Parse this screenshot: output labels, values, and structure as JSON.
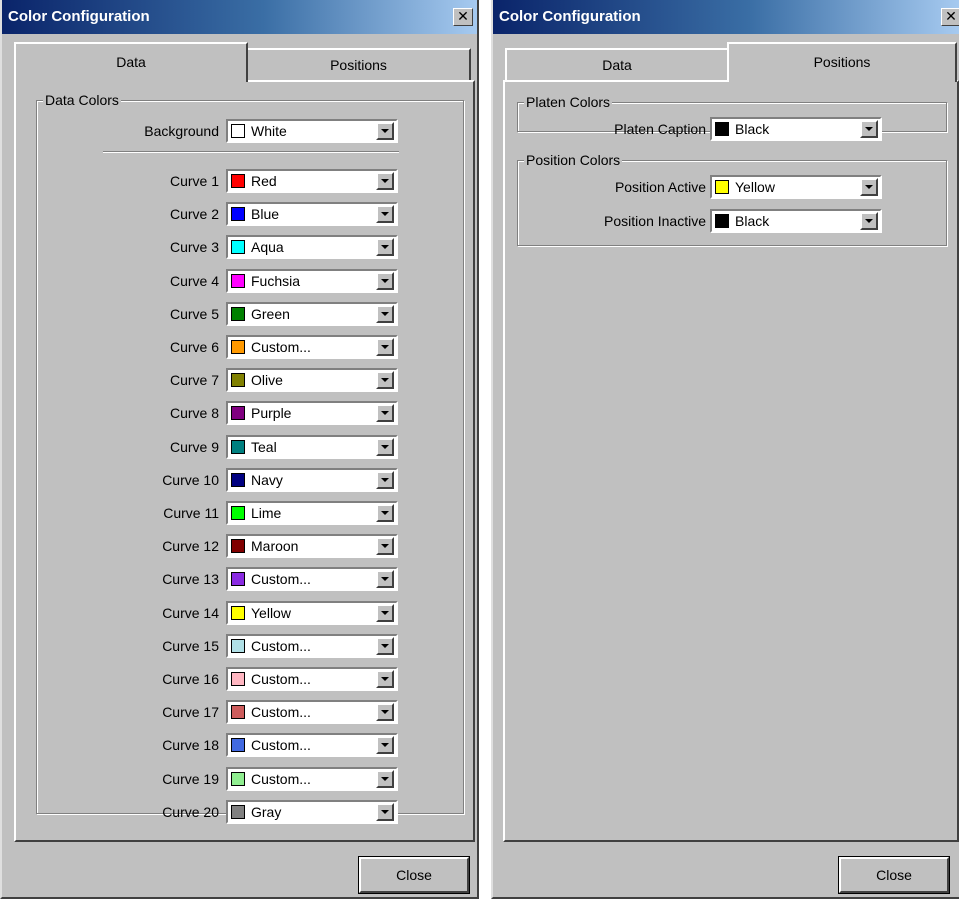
{
  "left_window": {
    "title": "Color Configuration",
    "close_glyph": "✕",
    "tabs": [
      {
        "label": "Data",
        "active": true
      },
      {
        "label": "Positions",
        "active": false
      }
    ],
    "group_label": "Data Colors",
    "background": {
      "label": "Background",
      "value": "White",
      "color": "#ffffff"
    },
    "curves": [
      {
        "label": "Curve 1",
        "value": "Red",
        "color": "#ff0000"
      },
      {
        "label": "Curve 2",
        "value": "Blue",
        "color": "#0000ff"
      },
      {
        "label": "Curve 3",
        "value": "Aqua",
        "color": "#00ffff"
      },
      {
        "label": "Curve 4",
        "value": "Fuchsia",
        "color": "#ff00ff"
      },
      {
        "label": "Curve 5",
        "value": "Green",
        "color": "#008000"
      },
      {
        "label": "Curve 6",
        "value": "Custom...",
        "color": "#ff9900"
      },
      {
        "label": "Curve 7",
        "value": "Olive",
        "color": "#808000"
      },
      {
        "label": "Curve 8",
        "value": "Purple",
        "color": "#800080"
      },
      {
        "label": "Curve 9",
        "value": "Teal",
        "color": "#008080"
      },
      {
        "label": "Curve 10",
        "value": "Navy",
        "color": "#000080"
      },
      {
        "label": "Curve 11",
        "value": "Lime",
        "color": "#00ff00"
      },
      {
        "label": "Curve 12",
        "value": "Maroon",
        "color": "#800000"
      },
      {
        "label": "Curve 13",
        "value": "Custom...",
        "color": "#8a2be2"
      },
      {
        "label": "Curve 14",
        "value": "Yellow",
        "color": "#ffff00"
      },
      {
        "label": "Curve 15",
        "value": "Custom...",
        "color": "#b0e0e6"
      },
      {
        "label": "Curve 16",
        "value": "Custom...",
        "color": "#ffb6c1"
      },
      {
        "label": "Curve 17",
        "value": "Custom...",
        "color": "#cd5c5c"
      },
      {
        "label": "Curve 18",
        "value": "Custom...",
        "color": "#4169e1"
      },
      {
        "label": "Curve 19",
        "value": "Custom...",
        "color": "#90ee90"
      },
      {
        "label": "Curve 20",
        "value": "Gray",
        "color": "#808080"
      }
    ],
    "close_label": "Close"
  },
  "right_window": {
    "title": "Color Configuration",
    "close_glyph": "✕",
    "tabs": [
      {
        "label": "Data",
        "active": false
      },
      {
        "label": "Positions",
        "active": true
      }
    ],
    "platen_group_label": "Platen Colors",
    "platen_caption": {
      "label": "Platen Caption",
      "value": "Black",
      "color": "#000000"
    },
    "position_group_label": "Position Colors",
    "position_active": {
      "label": "Position Active",
      "value": "Yellow",
      "color": "#ffff00"
    },
    "position_inactive": {
      "label": "Position Inactive",
      "value": "Black",
      "color": "#000000"
    },
    "close_label": "Close"
  }
}
